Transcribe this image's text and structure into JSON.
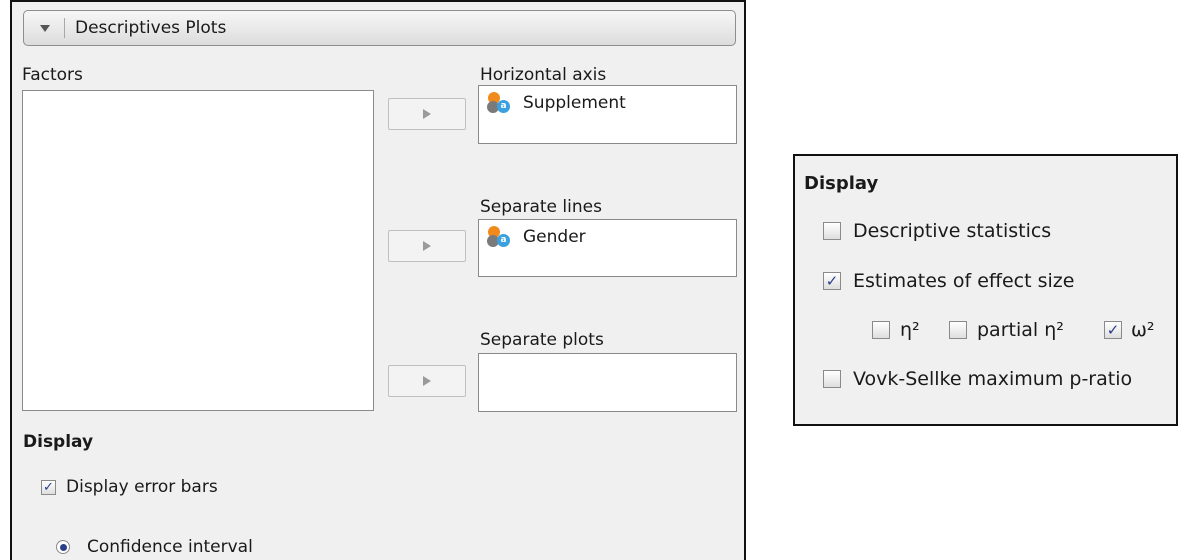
{
  "left_panel": {
    "section_title": "Descriptives Plots",
    "factors_label": "Factors",
    "horizontal_axis": {
      "label": "Horizontal axis",
      "items": [
        "Supplement"
      ]
    },
    "separate_lines": {
      "label": "Separate lines",
      "items": [
        "Gender"
      ]
    },
    "separate_plots": {
      "label": "Separate plots",
      "items": []
    },
    "display_heading": "Display",
    "display_error_bars": {
      "label": "Display error bars",
      "checked": true
    },
    "confidence_interval": {
      "label": "Confidence interval",
      "selected": true
    }
  },
  "right_panel": {
    "heading": "Display",
    "descriptive_statistics": {
      "label": "Descriptive statistics",
      "checked": false
    },
    "estimates_effect_size": {
      "label": "Estimates of effect size",
      "checked": true
    },
    "eta_squared": {
      "label": "η²",
      "checked": false
    },
    "partial_eta_squared": {
      "label": "partial η²",
      "checked": false
    },
    "omega_squared": {
      "label": "ω²",
      "checked": true
    },
    "vovk_sellke": {
      "label": "Vovk-Sellke maximum p-ratio",
      "checked": false
    }
  },
  "icons": {
    "nominal_variable": "nominal-variable-icon",
    "arrow": "play-arrow-icon"
  }
}
